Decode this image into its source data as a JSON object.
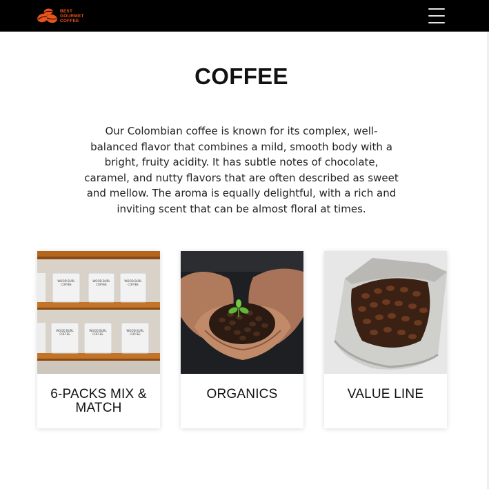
{
  "header": {
    "logo_lines": [
      "BEST",
      "GOURMET",
      "COFFEE"
    ],
    "logo_icon": "coffee-beans-logo",
    "menu_icon": "hamburger-menu-icon",
    "brand_color": "#e8541c",
    "background": "#000000"
  },
  "main": {
    "title": "COFFEE",
    "intro": "Our Colombian coffee is known for its complex, well-balanced flavor that combines a mild, smooth body with a bright, fruity acidity. It has subtle notes of chocolate, caramel, and nutty flavors that are often described as sweet and mellow. The aroma is equally delightful, with a rich and inviting scent that can be almost floral at times."
  },
  "cards": [
    {
      "title": "6-PACKS MIX & MATCH",
      "image": "coffee-bags-on-shelves",
      "bag_label": [
        "WOOD BURL",
        "COFFEE"
      ]
    },
    {
      "title": "ORGANICS",
      "image": "hands-holding-beans-with-sprout"
    },
    {
      "title": "VALUE LINE",
      "image": "open-bag-of-beans"
    }
  ]
}
